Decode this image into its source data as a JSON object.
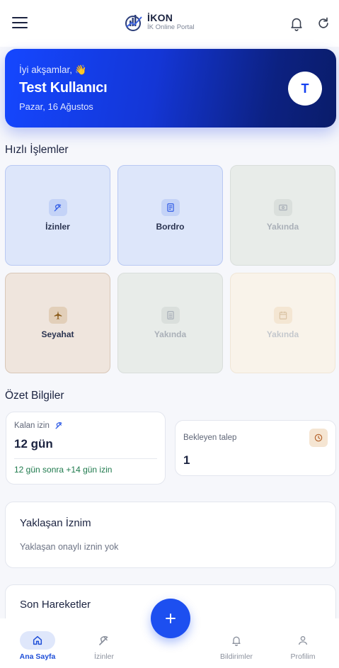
{
  "header": {
    "brand_title": "İKON",
    "brand_subtitle": "İK Online Portal"
  },
  "greeting": {
    "salutation": "İyi akşamlar, 👋",
    "user_name": "Test Kullanıcı",
    "date": "Pazar, 16 Ağustos",
    "avatar_initial": "T"
  },
  "quick_actions": {
    "title": "Hızlı İşlemler",
    "items": [
      {
        "label": "İzinler",
        "icon": "leave-icon",
        "enabled": true
      },
      {
        "label": "Bordro",
        "icon": "payroll-icon",
        "enabled": true
      },
      {
        "label": "Yakında",
        "icon": "money-icon",
        "enabled": false
      },
      {
        "label": "Seyahat",
        "icon": "airplane-icon",
        "enabled": true
      },
      {
        "label": "Yakında",
        "icon": "document-icon",
        "enabled": false
      },
      {
        "label": "Yakında",
        "icon": "calendar-icon",
        "enabled": false
      }
    ]
  },
  "summary": {
    "title": "Özet Bilgiler",
    "remaining_leave": {
      "label": "Kalan izin",
      "value": "12 gün",
      "note": "12 gün sonra +14 gün izin"
    },
    "pending_requests": {
      "label": "Bekleyen talep",
      "value": "1"
    }
  },
  "upcoming_leave": {
    "title": "Yaklaşan İznim",
    "empty_text": "Yaklaşan onaylı iznin yok"
  },
  "recent_activity": {
    "title": "Son Hareketler"
  },
  "bottom_nav": {
    "items": [
      {
        "label": "Ana Sayfa",
        "icon": "home-icon",
        "active": true
      },
      {
        "label": "İzinler",
        "icon": "leave-icon",
        "active": false
      },
      {
        "label": "Bildirimler",
        "icon": "bell-icon",
        "active": false
      },
      {
        "label": "Profilim",
        "icon": "user-icon",
        "active": false
      }
    ]
  },
  "colors": {
    "accent": "#1d4ff0",
    "hero_gradient_start": "#1547ff",
    "hero_gradient_end": "#0a1c6a",
    "leave_note_green": "#1f7a4d"
  }
}
